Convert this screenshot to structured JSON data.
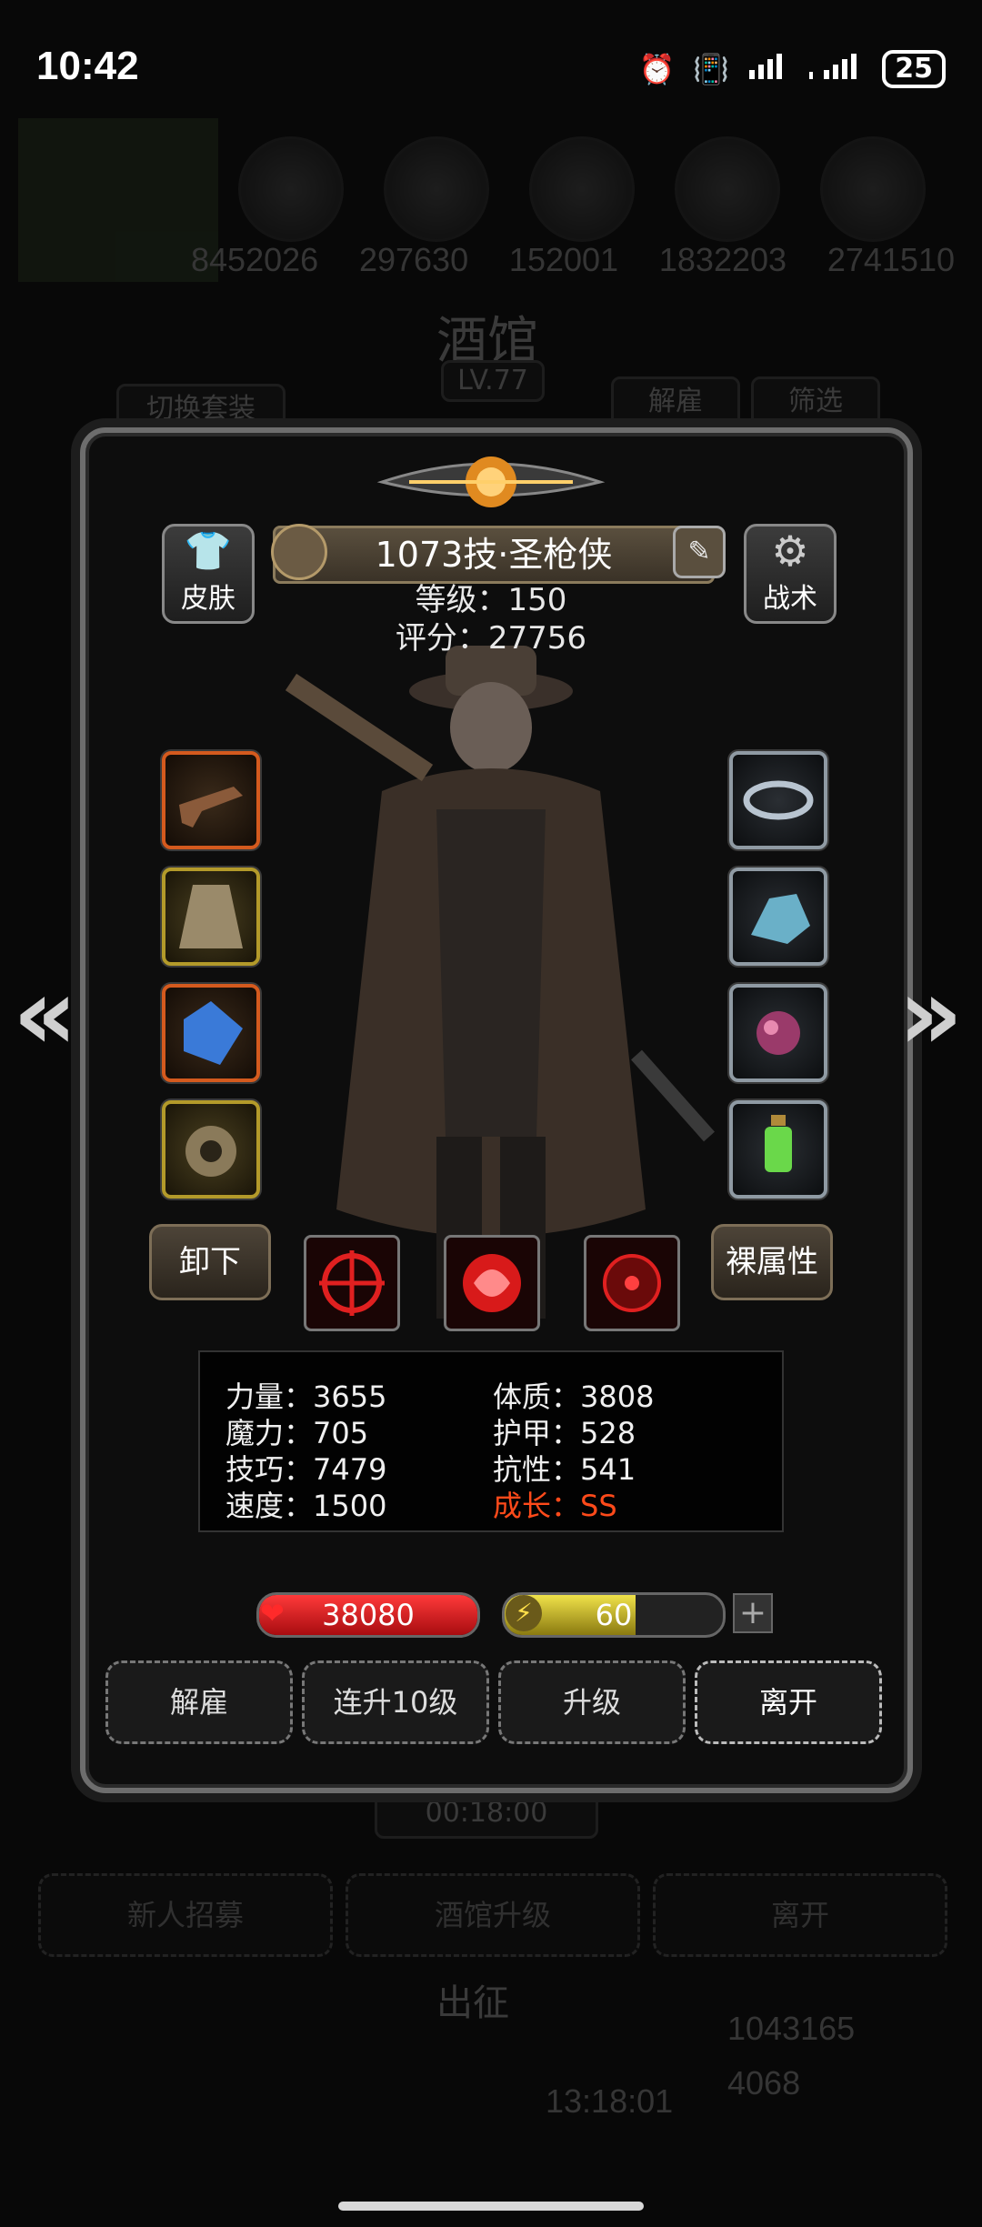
{
  "status_bar": {
    "time": "10:42",
    "battery": "25"
  },
  "background": {
    "resources": [
      "8452026",
      "297630",
      "152001",
      "1832203",
      "2741510"
    ],
    "title": "酒馆",
    "level": "LV.77",
    "switch_outfit": "切换套装",
    "dismiss": "解雇",
    "filter": "筛选",
    "timer": "00:18:00",
    "recruit": "新人招募",
    "upgrade_tavern": "酒馆升级",
    "leave": "离开",
    "expedition": "出征",
    "countdown": "13:18:01",
    "gold": "1043165",
    "gems": "4068"
  },
  "hero": {
    "name": "1073技·圣枪侠",
    "level": "等级：150",
    "score": "评分：27756",
    "skin_label": "皮肤",
    "tactics_label": "战术"
  },
  "equipment": {
    "left": [
      "flintlock-pistol",
      "fur-cloak",
      "blue-gem",
      "stone-ring"
    ],
    "right": [
      "silver-bracelet",
      "crystal-rock",
      "purple-orb",
      "green-lantern"
    ]
  },
  "actions": {
    "unequip": "卸下",
    "naked_stats": "裸属性"
  },
  "stats": {
    "strength": "力量：3655",
    "constitution": "体质：3808",
    "magic": "魔力：705",
    "armor": "护甲：528",
    "skill": "技巧：7479",
    "resistance": "抗性：541",
    "speed": "速度：1500",
    "growth": "成长：SS"
  },
  "bars": {
    "hp": "38080",
    "hp_fill": 1.0,
    "energy": "60",
    "energy_fill": 0.6,
    "plus": "+"
  },
  "buttons": {
    "dismiss": "解雇",
    "level_up_10": "连升10级",
    "level_up": "升级",
    "leave": "离开"
  },
  "colors": {
    "growth": "#ff4a1a",
    "hp": "#d8141c",
    "energy": "#d4c41a"
  }
}
